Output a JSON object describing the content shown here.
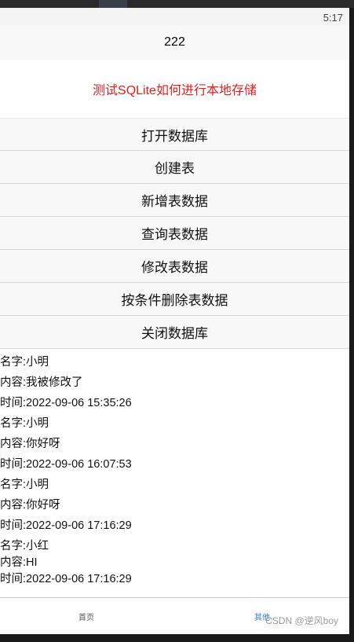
{
  "status": {
    "time": "5:17"
  },
  "nav": {
    "title": "222"
  },
  "headline": "测试SQLite如何进行本地存储",
  "buttons": [
    "打开数据库",
    "创建表",
    "新增表数据",
    "查询表数据",
    "修改表数据",
    "按条件删除表数据",
    "关闭数据库"
  ],
  "records": [
    {
      "name": "名字:小明",
      "content": "内容:我被修改了",
      "time": "时间:2022-09-06 15:35:26"
    },
    {
      "name": "名字:小明",
      "content": "内容:你好呀",
      "time": "时间:2022-09-06 16:07:53"
    },
    {
      "name": "名字:小明",
      "content": "内容:你好呀",
      "time": "时间:2022-09-06 17:16:29"
    },
    {
      "name": "名字:小红",
      "content": "内容:HI",
      "time": "时间:2022-09-06 17:16:29"
    }
  ],
  "tabbar": {
    "home_label": "首页",
    "other_label": "其他"
  },
  "watermark": "CSDN @逆风boy",
  "colors": {
    "headline": "#e02020",
    "active_tab": "#2f7de1",
    "button_bg": "#f8f8f8"
  }
}
